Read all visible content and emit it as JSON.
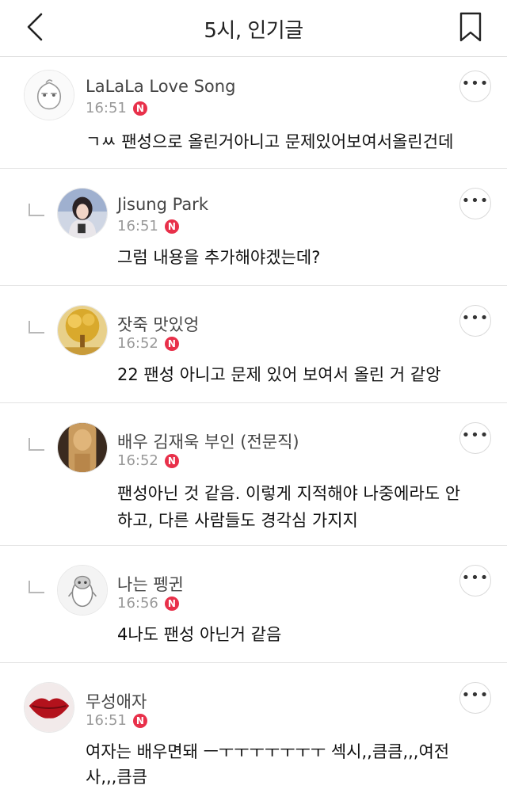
{
  "header": {
    "title": "5시, 인기글",
    "back_icon": "chevron-left-icon",
    "bookmark_icon": "bookmark-icon"
  },
  "comments": [
    {
      "nickname": "LaLaLa Love Song",
      "time": "16:51",
      "badge": "N",
      "text": "ㄱㅆ 팬성으로 올린거아니고 문제있어보여서올린건데",
      "is_reply": false
    },
    {
      "nickname": "Jisung Park",
      "time": "16:51",
      "badge": "N",
      "text": "그럼 내용을 추가해야겠는데?",
      "is_reply": true
    },
    {
      "nickname": "잣죽 맛있엉",
      "time": "16:52",
      "badge": "N",
      "text": "22 팬성 아니고 문제 있어 보여서 올린 거 같앙",
      "is_reply": true
    },
    {
      "nickname": "배우 김재욱 부인 (전문직)",
      "time": "16:52",
      "badge": "N",
      "text_line1": "팬성아닌 것 같음. 이렇게 지적해야 나중에라도 안",
      "text_line2": "하고, 다른 사람들도 경각심 가지지",
      "is_reply": true
    },
    {
      "nickname": "나는 펭귄",
      "time": "16:56",
      "badge": "N",
      "text": "4나도 팬성 아닌거 같음",
      "is_reply": true
    },
    {
      "nickname": "무성애자",
      "time": "16:51",
      "badge": "N",
      "text_line1": "여자는 배우면돼 ㅡㅜㅜㅜㅜㅜㅜㅜ 섹시,,큼큼,,,여전",
      "text_line2": "사,,,큼큼",
      "is_reply": false
    }
  ],
  "more_label": "•••",
  "colors": {
    "badge": "#e8304a",
    "divider": "#e3e3e3",
    "meta": "#999999"
  }
}
